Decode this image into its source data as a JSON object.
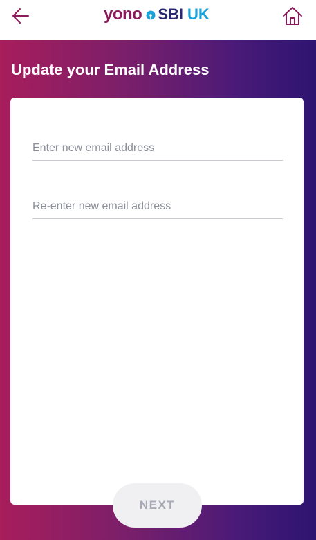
{
  "header": {
    "logo": {
      "yono": "yono",
      "sbi": "SBI",
      "region": "UK"
    },
    "back_icon": "arrow-left-icon",
    "home_icon": "home-icon"
  },
  "page": {
    "title": "Update your Email Address"
  },
  "form": {
    "new_email": {
      "value": "",
      "placeholder": "Enter new email address"
    },
    "confirm_email": {
      "value": "",
      "placeholder": "Re-enter new email address"
    },
    "next_label": "NEXT"
  },
  "colors": {
    "brand_magenta": "#a81d5c",
    "brand_indigo": "#2d1470",
    "logo_yono": "#8a1c5b",
    "logo_sbi": "#2a2a72",
    "logo_uk": "#1aa3d9",
    "button_disabled_bg": "#f0f0f2",
    "button_disabled_text": "#a7aab6"
  }
}
